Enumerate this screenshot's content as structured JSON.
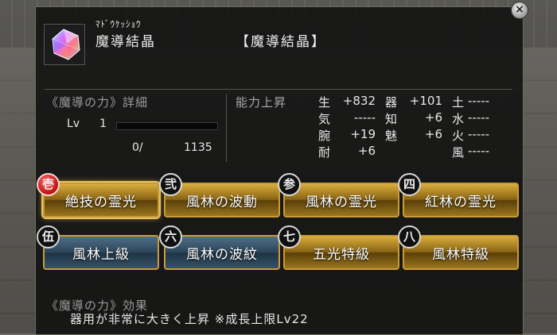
{
  "window": {
    "close_label": "×"
  },
  "item": {
    "icon": "crystal-icon",
    "reading": "ﾏﾄﾞｳｹｯｼｮｳ",
    "name": "魔導結晶",
    "category": "【魔導結晶】"
  },
  "details": {
    "title": "《魔導の力》詳細",
    "lv_label": "Lv",
    "lv_value": "1",
    "xp_current": "0/",
    "xp_max": "1135",
    "xp_progress": 0
  },
  "stats": {
    "title": "能力上昇",
    "col1": [
      {
        "label": "生",
        "value": "+832"
      },
      {
        "label": "気",
        "value": "-----"
      },
      {
        "label": "腕",
        "value": "+19"
      },
      {
        "label": "耐",
        "value": "+6"
      }
    ],
    "col2": [
      {
        "label": "器",
        "value": "+101"
      },
      {
        "label": "知",
        "value": "+6"
      },
      {
        "label": "魅",
        "value": "+6"
      }
    ],
    "col3": [
      {
        "label": "土",
        "value": "-----"
      },
      {
        "label": "水",
        "value": "-----"
      },
      {
        "label": "火",
        "value": "-----"
      },
      {
        "label": "風",
        "value": "-----"
      }
    ]
  },
  "skills": [
    {
      "badge": "壱",
      "label": "絶技の霊光",
      "style": "gold",
      "active": true
    },
    {
      "badge": "弐",
      "label": "風林の波動",
      "style": "gold",
      "active": false
    },
    {
      "badge": "参",
      "label": "風林の霊光",
      "style": "gold",
      "active": false
    },
    {
      "badge": "四",
      "label": "紅林の霊光",
      "style": "gold",
      "active": false
    },
    {
      "badge": "伍",
      "label": "風林上級",
      "style": "blue",
      "active": false
    },
    {
      "badge": "六",
      "label": "風林の波紋",
      "style": "blue",
      "active": false
    },
    {
      "badge": "七",
      "label": "五光特級",
      "style": "gold",
      "active": false
    },
    {
      "badge": "八",
      "label": "風林特級",
      "style": "gold",
      "active": false
    }
  ],
  "effect": {
    "title": "《魔導の力》効果",
    "text": "器用が非常に大きく上昇 ※成長上限Lv22"
  },
  "colors": {
    "gold": "#c79b39",
    "blue": "#2b4559",
    "panel": "#0e0e0e",
    "badge_red": "#c01010"
  }
}
